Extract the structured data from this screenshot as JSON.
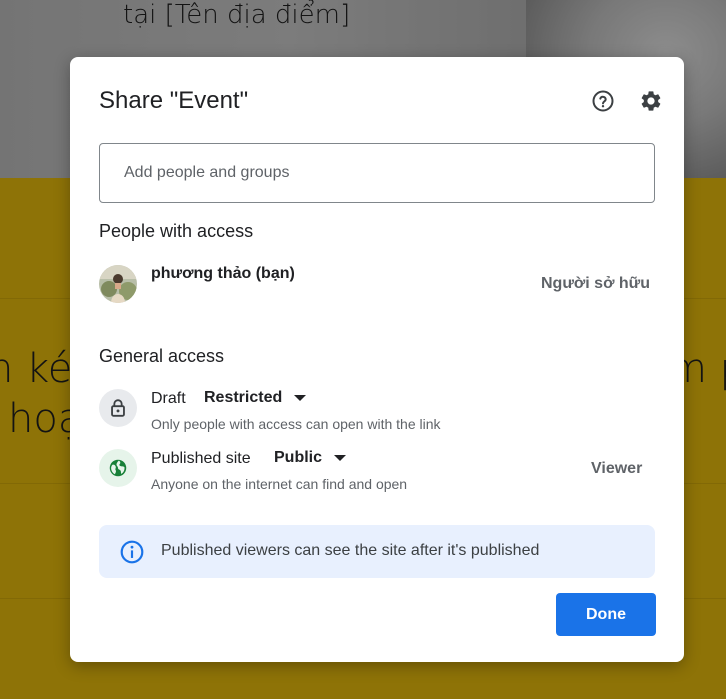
{
  "background": {
    "top_text": "tại [Tên địa điểm]",
    "left_text_line1": "n ké",
    "left_text_line2": "hoạ",
    "right_text": "m p"
  },
  "dialog": {
    "title": "Share \"Event\"",
    "help_icon": "help-circle-icon",
    "settings_icon": "gear-icon",
    "add_people_placeholder": "Add people and groups",
    "people_section_title": "People with access",
    "person": {
      "name": "phương thảo (bạn)",
      "role": "Người sở hữu"
    },
    "general_section_title": "General access",
    "draft": {
      "label": "Draft",
      "access_value": "Restricted",
      "description": "Only people with access can open with the link"
    },
    "published": {
      "label": "Published site",
      "access_value": "Public",
      "description": "Anyone on the internet can find and open",
      "role": "Viewer"
    },
    "info_banner_text": "Published viewers can see the site after it's published",
    "done_label": "Done"
  },
  "colors": {
    "primary": "#1a73e8",
    "banner_bg": "#e8f0fe",
    "globe_green": "#188038",
    "background_yellow": "#f4c60d"
  }
}
